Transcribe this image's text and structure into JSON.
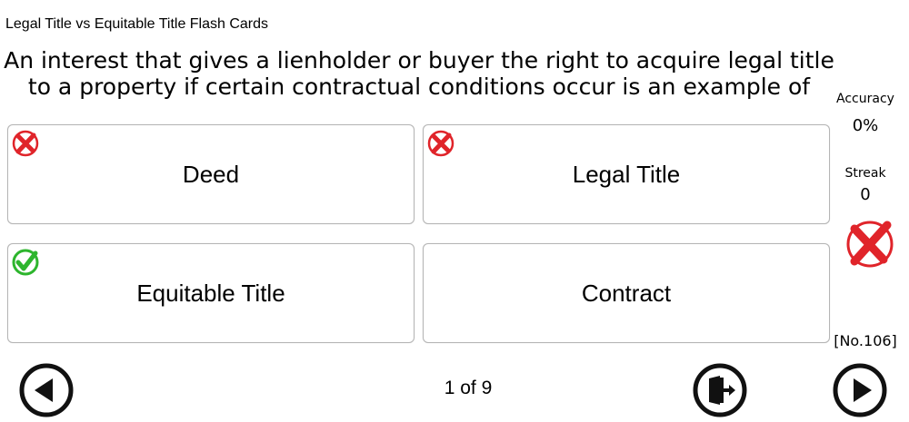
{
  "app": {
    "title": "Legal Title vs Equitable Title Flash Cards"
  },
  "question": {
    "text": "An interest that gives a lienholder or buyer the right to acquire legal title to a property if certain contractual conditions occur is an example of"
  },
  "answers": [
    {
      "label": "Deed",
      "status": "incorrect",
      "icon": "x-circle-icon"
    },
    {
      "label": "Legal Title",
      "status": "incorrect",
      "icon": "x-circle-icon"
    },
    {
      "label": "Equitable Title",
      "status": "correct",
      "icon": "check-circle-icon"
    },
    {
      "label": "Contract",
      "status": "unmarked",
      "icon": ""
    }
  ],
  "stats": {
    "accuracy_label": "Accuracy",
    "accuracy_value": "0%",
    "streak_label": "Streak",
    "streak_value": "0",
    "result_icon": "big-x-icon",
    "card_number": "[No.106]"
  },
  "navigation": {
    "page_indicator": "1 of 9",
    "prev_icon": "arrow-left-icon",
    "exit_icon": "exit-door-icon",
    "next_icon": "arrow-right-icon"
  },
  "colors": {
    "correct": "#2db52d",
    "incorrect": "#e0242a",
    "ink": "#111111"
  }
}
